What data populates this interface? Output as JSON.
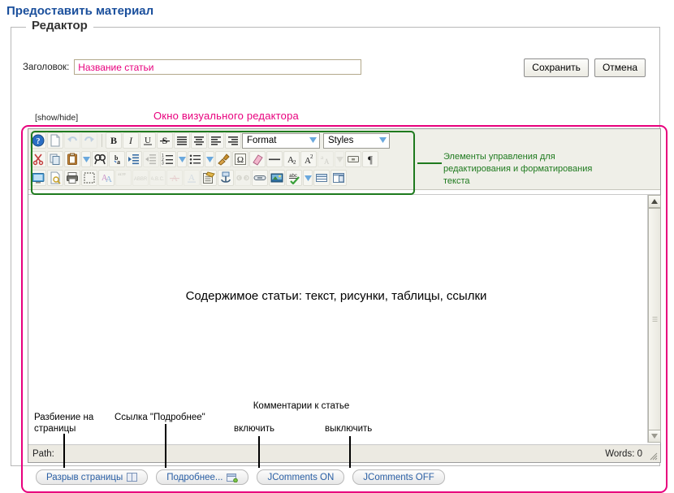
{
  "page": {
    "title": "Предоставить материал",
    "title_color": "#1a4f9c"
  },
  "fieldset": {
    "legend": "Редактор"
  },
  "form": {
    "title_label": "Заголовок:",
    "title_value": "Название статьи",
    "title_placeholder": "Название статьи",
    "showhide_label": "[show/hide]",
    "save_label": "Сохранить",
    "cancel_label": "Отмена"
  },
  "annotations": {
    "editor_window": "Окно визуального редактора",
    "toolbar": "Элементы управления для редактирования и форматирования текста",
    "pagebreak": "Разбиение на страницы",
    "readmore": "Ссылка \"Подробнее\"",
    "comments": "Комментарии к статье",
    "comments_on": "включить",
    "comments_off": "выключить",
    "color_magenta": "#e8007d",
    "color_green": "#1e7a1e"
  },
  "editor": {
    "content_text": "Содержимое статьи: текст, рисунки, таблицы, ссылки",
    "status_path": "Path:",
    "status_words": "Words: 0",
    "format_select": "Format",
    "styles_select": "Styles",
    "toolbar_rows": [
      [
        {
          "name": "about-icon",
          "title": "About"
        },
        {
          "name": "new-page-icon",
          "title": "New Page"
        },
        {
          "name": "undo-icon",
          "title": "Undo",
          "disabled": true
        },
        {
          "name": "redo-icon",
          "title": "Redo",
          "disabled": true
        },
        {
          "sep": true
        },
        {
          "name": "bold-icon",
          "title": "Bold"
        },
        {
          "name": "italic-icon",
          "title": "Italic"
        },
        {
          "name": "underline-icon",
          "title": "Underline"
        },
        {
          "name": "strikethrough-icon",
          "title": "Strike Through"
        },
        {
          "name": "align-justify-icon",
          "title": "Justify"
        },
        {
          "name": "align-center-icon",
          "title": "Center"
        },
        {
          "name": "align-left-icon",
          "title": "Align Left"
        },
        {
          "name": "align-right-icon",
          "title": "Align Right"
        }
      ],
      [
        {
          "name": "cut-icon",
          "title": "Cut"
        },
        {
          "name": "copy-icon",
          "title": "Copy"
        },
        {
          "name": "paste-icon",
          "title": "Paste"
        },
        {
          "name": "paste-dropdown-arrow-icon",
          "title": "Paste options"
        },
        {
          "name": "find-icon",
          "title": "Find"
        },
        {
          "name": "replace-icon",
          "title": "Replace"
        },
        {
          "name": "indent-increase-icon",
          "title": "Increase Indent"
        },
        {
          "name": "indent-decrease-icon",
          "title": "Decrease Indent",
          "disabled": true
        },
        {
          "name": "numbered-list-icon",
          "title": "Numbered List"
        },
        {
          "name": "numbered-list-dropdown-arrow-icon",
          "title": "Numbered list options"
        },
        {
          "name": "bulleted-list-icon",
          "title": "Bulleted List"
        },
        {
          "name": "bulleted-list-dropdown-arrow-icon",
          "title": "Bulleted list options"
        },
        {
          "name": "remove-format-icon",
          "title": "Remove Format"
        },
        {
          "name": "special-char-icon",
          "title": "Insert Special Character"
        },
        {
          "name": "eraser-icon",
          "title": "Erase"
        },
        {
          "name": "horizontal-rule-icon",
          "title": "Horizontal Rule"
        },
        {
          "name": "subscript-icon",
          "title": "Subscript"
        },
        {
          "name": "superscript-icon",
          "title": "Superscript"
        },
        {
          "name": "anchor-text-icon",
          "title": "Anchor",
          "disabled": true
        },
        {
          "name": "anchor-dropdown-arrow-icon",
          "title": "Anchor options",
          "disabled": true
        },
        {
          "name": "insert-field-icon",
          "title": "Insert Field"
        },
        {
          "name": "show-blocks-icon",
          "title": "Show Blocks"
        }
      ],
      [
        {
          "name": "fullscreen-icon",
          "title": "Maximize"
        },
        {
          "name": "preview-icon",
          "title": "Preview"
        },
        {
          "name": "print-icon",
          "title": "Print"
        },
        {
          "name": "select-all-icon",
          "title": "Select All"
        },
        {
          "name": "text-color-icon",
          "title": "Text Color"
        },
        {
          "name": "blockquote-icon",
          "title": "Block Quote",
          "disabled": true
        },
        {
          "name": "abbreviation-icon",
          "title": "Abbreviation",
          "disabled": true
        },
        {
          "name": "acronym-icon",
          "title": "Acronym",
          "disabled": true
        },
        {
          "name": "delete-text-icon",
          "title": "Deleted Text",
          "disabled": true
        },
        {
          "name": "inserted-text-icon",
          "title": "Inserted Text",
          "disabled": true
        },
        {
          "name": "templates-icon",
          "title": "Templates"
        },
        {
          "name": "anchor-icon",
          "title": "Insert Anchor"
        },
        {
          "name": "unlink-icon",
          "title": "Unlink",
          "disabled": true
        },
        {
          "name": "link-icon",
          "title": "Insert Link"
        },
        {
          "name": "image-icon",
          "title": "Insert Image"
        },
        {
          "name": "spellcheck-icon",
          "title": "Spell Check"
        },
        {
          "name": "spellcheck-dropdown-arrow-icon",
          "title": "Spell check options"
        },
        {
          "name": "table-icon",
          "title": "Insert Table"
        },
        {
          "name": "div-container-icon",
          "title": "Create Div Container"
        }
      ]
    ]
  },
  "joomla_buttons": [
    {
      "label": "Разрыв страницы",
      "icon": "pagebreak-icon"
    },
    {
      "label": "Подробнее...",
      "icon": "readmore-icon"
    },
    {
      "label": "JComments ON",
      "icon": ""
    },
    {
      "label": "JComments OFF",
      "icon": ""
    }
  ]
}
